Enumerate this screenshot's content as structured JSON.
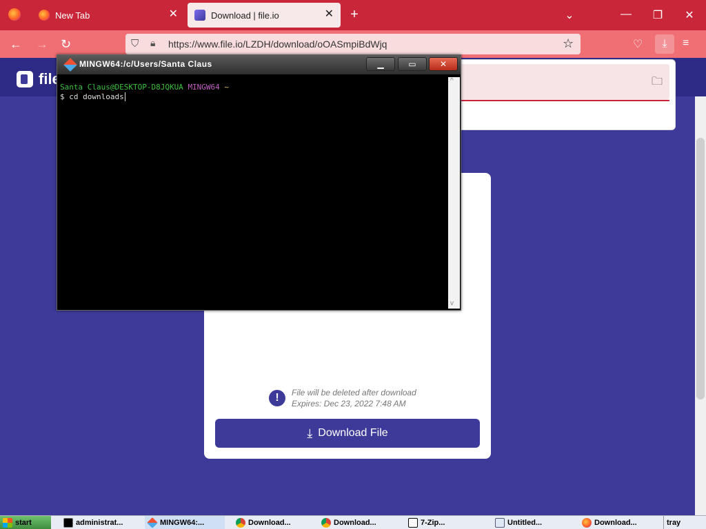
{
  "browser": {
    "tabs": [
      {
        "label": "New Tab",
        "active": false
      },
      {
        "label": "Download | file.io",
        "active": true
      }
    ],
    "url": "https://www.file.io/LZDH/download/oOASmpiBdWjq"
  },
  "page": {
    "logo_text": "file",
    "notice_line1": "File will be deleted after download",
    "notice_line2": "Expires: Dec 23, 2022 7:48 AM",
    "download_label": "Download File"
  },
  "terminal": {
    "title": "MINGW64:/c/Users/Santa Claus",
    "prompt_user": "Santa Claus@DESKTOP-D8JQKUA",
    "prompt_env": "MINGW64",
    "prompt_dir": "~",
    "command": "$ cd downloads"
  },
  "taskbar": {
    "start": "start",
    "items": [
      "administrat...",
      "MINGW64:...",
      "Download...",
      "Download...",
      "7-Zip...",
      "Untitled...",
      "Download...",
      "tray"
    ]
  },
  "colors": {
    "tab_strip": "#c9263a",
    "nav_bar": "#ef6f74",
    "page_bg": "#3d3a9a",
    "button": "#3d3a9a"
  }
}
